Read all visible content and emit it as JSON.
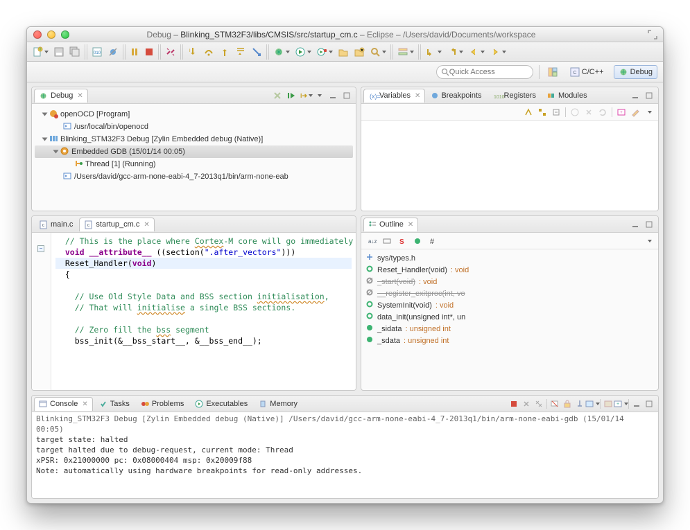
{
  "title": {
    "prefix": "Debug – ",
    "file": "Blinking_STM32F3/libs/CMSIS/src/startup_cm.c",
    "mid": " – Eclipse – ",
    "workspace": "/Users/david/Documents/workspace"
  },
  "quickAccess": {
    "placeholder": "Quick Access"
  },
  "perspectives": {
    "cpp": "C/C++",
    "debug": "Debug"
  },
  "debugView": {
    "tab": "Debug",
    "tree": [
      {
        "lvl": 0,
        "label": "openOCD [Program]",
        "icon": "gear-red",
        "sel": false,
        "open": true
      },
      {
        "lvl": 1,
        "label": "/usr/local/bin/openocd",
        "icon": "term",
        "sel": false
      },
      {
        "lvl": 0,
        "label": "Blinking_STM32F3 Debug [Zylin Embedded debug (Native)]",
        "icon": "blue-bars",
        "sel": false,
        "open": true
      },
      {
        "lvl": 1,
        "label": "Embedded GDB (15/01/14 00:05)",
        "icon": "gear-orange",
        "sel": true,
        "open": true
      },
      {
        "lvl": 2,
        "label": "Thread [1] (Running)",
        "icon": "thread",
        "sel": false
      },
      {
        "lvl": 1,
        "label": "/Users/david/gcc-arm-none-eabi-4_7-2013q1/bin/arm-none-eab",
        "icon": "term",
        "sel": false
      }
    ]
  },
  "rightTabs": {
    "variables": "Variables",
    "breakpoints": "Breakpoints",
    "registers": "Registers",
    "modules": "Modules"
  },
  "editor": {
    "tabs": [
      {
        "name": "main.c",
        "active": false,
        "icon": "c-file"
      },
      {
        "name": "startup_cm.c",
        "active": true,
        "icon": "c-file"
      }
    ],
    "lines": [
      {
        "cls": "cmt",
        "t": "  // This is the place where Cortex-M core will go immediately after reset.",
        "wavy": "Cortex"
      },
      {
        "cls": "",
        "t": "  void __attribute__ ((section(\".after_vectors\")))",
        "kw": [
          "void",
          "__attribute__"
        ],
        "str": "\".after_vectors\"",
        "fold": true
      },
      {
        "cls": "hl",
        "t": "  Reset_Handler(void)",
        "kw": [
          "void"
        ]
      },
      {
        "cls": "",
        "t": "  {"
      },
      {
        "cls": "",
        "t": ""
      },
      {
        "cls": "cmt",
        "t": "    // Use Old Style Data and BSS section initialisation,",
        "wavy": "initialisation"
      },
      {
        "cls": "cmt",
        "t": "    // That will initialise a single BSS sections.",
        "wavy": "initialise"
      },
      {
        "cls": "",
        "t": ""
      },
      {
        "cls": "cmt",
        "t": "    // Zero fill the bss segment",
        "wavy": "bss"
      },
      {
        "cls": "",
        "t": "    bss_init(&__bss_start__, &__bss_end__);"
      }
    ]
  },
  "outline": {
    "tab": "Outline",
    "items": [
      {
        "icon": "inc",
        "label": "sys/types.h"
      },
      {
        "icon": "fn",
        "label": "Reset_Handler(void)",
        "ret": "void"
      },
      {
        "icon": "fn-strike",
        "label": "_start(void)",
        "ret": "void"
      },
      {
        "icon": "fn-strike",
        "label": "__register_exitproc(int, vo"
      },
      {
        "icon": "fn",
        "label": "SystemInit(void)",
        "ret": "void"
      },
      {
        "icon": "fn",
        "label": "data_init(unsigned int*, un"
      },
      {
        "icon": "var",
        "label": "_sidata",
        "ret": "unsigned int"
      },
      {
        "icon": "var",
        "label": "_sdata",
        "ret": "unsigned int"
      }
    ]
  },
  "bottomTabs": {
    "console": "Console",
    "tasks": "Tasks",
    "problems": "Problems",
    "executables": "Executables",
    "memory": "Memory"
  },
  "console": {
    "header": "Blinking_STM32F3 Debug [Zylin Embedded debug (Native)] /Users/david/gcc-arm-none-eabi-4_7-2013q1/bin/arm-none-eabi-gdb (15/01/14 00:05)",
    "lines": [
      "target state: halted",
      "target halted due to debug-request, current mode: Thread",
      "xPSR: 0x21000000 pc: 0x08000404 msp: 0x20009f88",
      "Note: automatically using hardware breakpoints for read-only addresses."
    ]
  }
}
